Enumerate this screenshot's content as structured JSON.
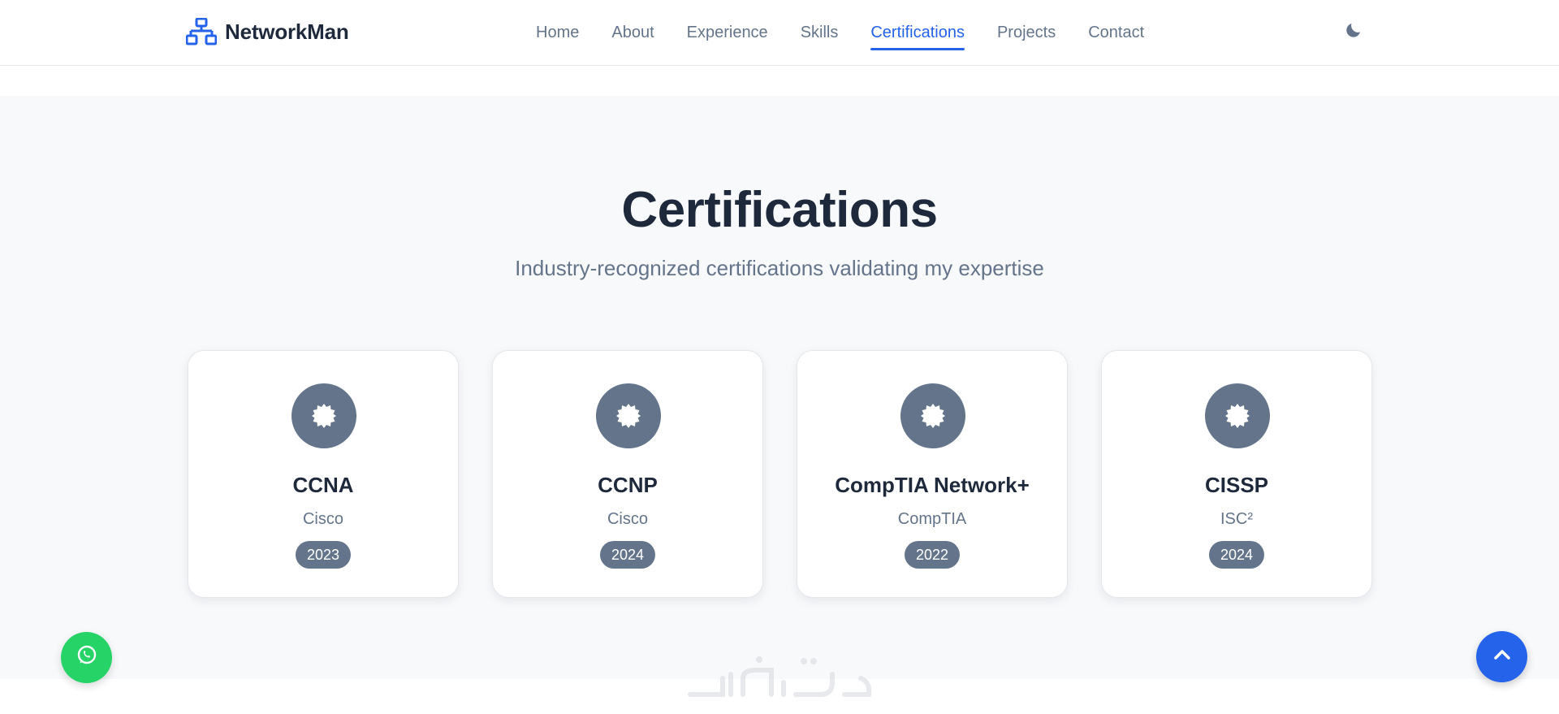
{
  "brand": {
    "name": "NetworkMan",
    "icon": "network-icon"
  },
  "nav": {
    "items": [
      {
        "label": "Home",
        "active": false
      },
      {
        "label": "About",
        "active": false
      },
      {
        "label": "Experience",
        "active": false
      },
      {
        "label": "Skills",
        "active": false
      },
      {
        "label": "Certifications",
        "active": true
      },
      {
        "label": "Projects",
        "active": false
      },
      {
        "label": "Contact",
        "active": false
      }
    ],
    "theme_toggle_icon": "moon-icon"
  },
  "section": {
    "title": "Certifications",
    "subtitle": "Industry-recognized certifications validating my expertise"
  },
  "certifications": [
    {
      "name": "CCNA",
      "issuer": "Cisco",
      "year": "2023",
      "icon": "certificate-icon"
    },
    {
      "name": "CCNP",
      "issuer": "Cisco",
      "year": "2024",
      "icon": "certificate-icon"
    },
    {
      "name": "CompTIA Network+",
      "issuer": "CompTIA",
      "year": "2022",
      "icon": "certificate-icon"
    },
    {
      "name": "CISSP",
      "issuer": "ISC²",
      "year": "2024",
      "icon": "certificate-icon"
    }
  ],
  "floating": {
    "whatsapp_icon": "whatsapp-icon",
    "scroll_top_icon": "chevron-up-icon"
  },
  "colors": {
    "accent": "#2563eb",
    "badge": "#64748b",
    "whatsapp": "#25d366",
    "section_bg": "#f8f9fb"
  }
}
